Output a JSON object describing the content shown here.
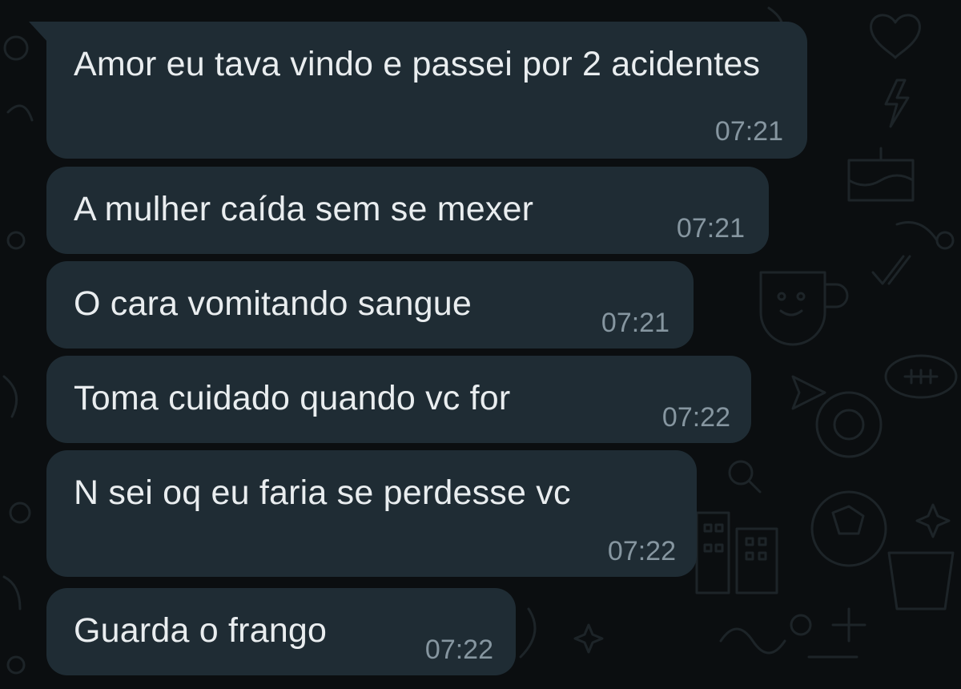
{
  "colors": {
    "background": "#0b0e10",
    "bubble": "#1f2c34",
    "text": "#e9edef",
    "timestamp": "#8696a0",
    "doodle": "#1d2428"
  },
  "messages": [
    {
      "text": "Amor eu tava vindo e passei por 2 acidentes",
      "time": "07:21"
    },
    {
      "text": "A mulher caída sem se mexer",
      "time": "07:21"
    },
    {
      "text": "O cara vomitando sangue",
      "time": "07:21"
    },
    {
      "text": "Toma cuidado quando vc for",
      "time": "07:22"
    },
    {
      "text": "N sei oq eu faria se perdesse vc",
      "time": "07:22"
    },
    {
      "text": "Guarda o frango",
      "time": "07:22"
    }
  ],
  "wallpaper_icons": [
    "heart-icon",
    "lightning-icon",
    "cake-icon",
    "cup-icon",
    "checkmark-icon",
    "football-icon",
    "send-icon",
    "search-icon",
    "globe-icon",
    "buildings-icon",
    "sparkle-icon",
    "star-icon",
    "plus-icon"
  ]
}
